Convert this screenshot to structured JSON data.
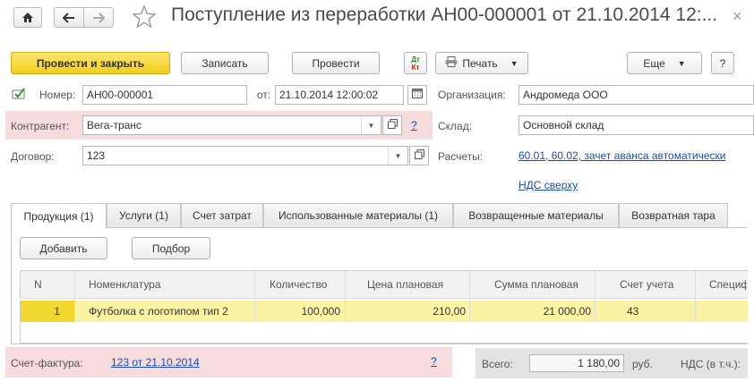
{
  "window": {
    "title": "Поступление из переработки АН00-000001 от 21.10.2014 12:...",
    "close_glyph": "×"
  },
  "toolbar": {
    "post_close_label": "Провести и закрыть",
    "save_label": "Записать",
    "post_label": "Провести",
    "dtkt_label_top": "Дт",
    "dtkt_label_bottom": "Кт",
    "print_label": "Печать",
    "more_label": "Еще",
    "help_label": "?"
  },
  "form": {
    "number_label": "Номер:",
    "number_value": "АН00-000001",
    "date_label": "от:",
    "date_value": "21.10.2014 12:00:02",
    "org_label": "Организация:",
    "org_value": "Андромеда ООО",
    "contractor_label": "Контрагент:",
    "contractor_value": "Вега-транс",
    "contractor_help": "?",
    "warehouse_label": "Склад:",
    "warehouse_value": "Основной склад",
    "contract_label": "Договор:",
    "contract_value": "123",
    "settlements_label": "Расчеты:",
    "settlements_link": "60.01, 60.02, зачет аванса автоматически",
    "vat_link": "НДС сверху"
  },
  "tabs": [
    {
      "label": "Продукция (1)",
      "active": true
    },
    {
      "label": "Услуги (1)",
      "active": false
    },
    {
      "label": "Счет затрат",
      "active": false
    },
    {
      "label": "Использованные материалы (1)",
      "active": false
    },
    {
      "label": "Возвращенные материалы",
      "active": false
    },
    {
      "label": "Возвратная тара",
      "active": false
    }
  ],
  "table_toolbar": {
    "add_label": "Добавить",
    "select_label": "Подбор"
  },
  "table": {
    "columns": [
      "N",
      "Номенклатура",
      "Количество",
      "Цена плановая",
      "Сумма плановая",
      "Счет учета",
      "Специф"
    ],
    "rows": [
      {
        "n": "1",
        "item": "Футболка с логотипом тип 2",
        "qty": "100,000",
        "price": "210,00",
        "sum": "21 000,00",
        "account": "43",
        "spec": ""
      }
    ],
    "selected_row_color": "#fbf3a4",
    "selected_n_color": "#f4d832"
  },
  "footer": {
    "invoice_label": "Счет-фактура:",
    "invoice_link": "123 от 21.10.2014",
    "invoice_help": "?",
    "total_label": "Всего:",
    "total_value": "1 180,00",
    "currency": "руб.",
    "vat_label": "НДС (в т.ч.):"
  },
  "colors": {
    "accent_yellow": "#f2cd1c",
    "link": "#1a4db8",
    "highlight_pink": "#f6dcdc"
  }
}
